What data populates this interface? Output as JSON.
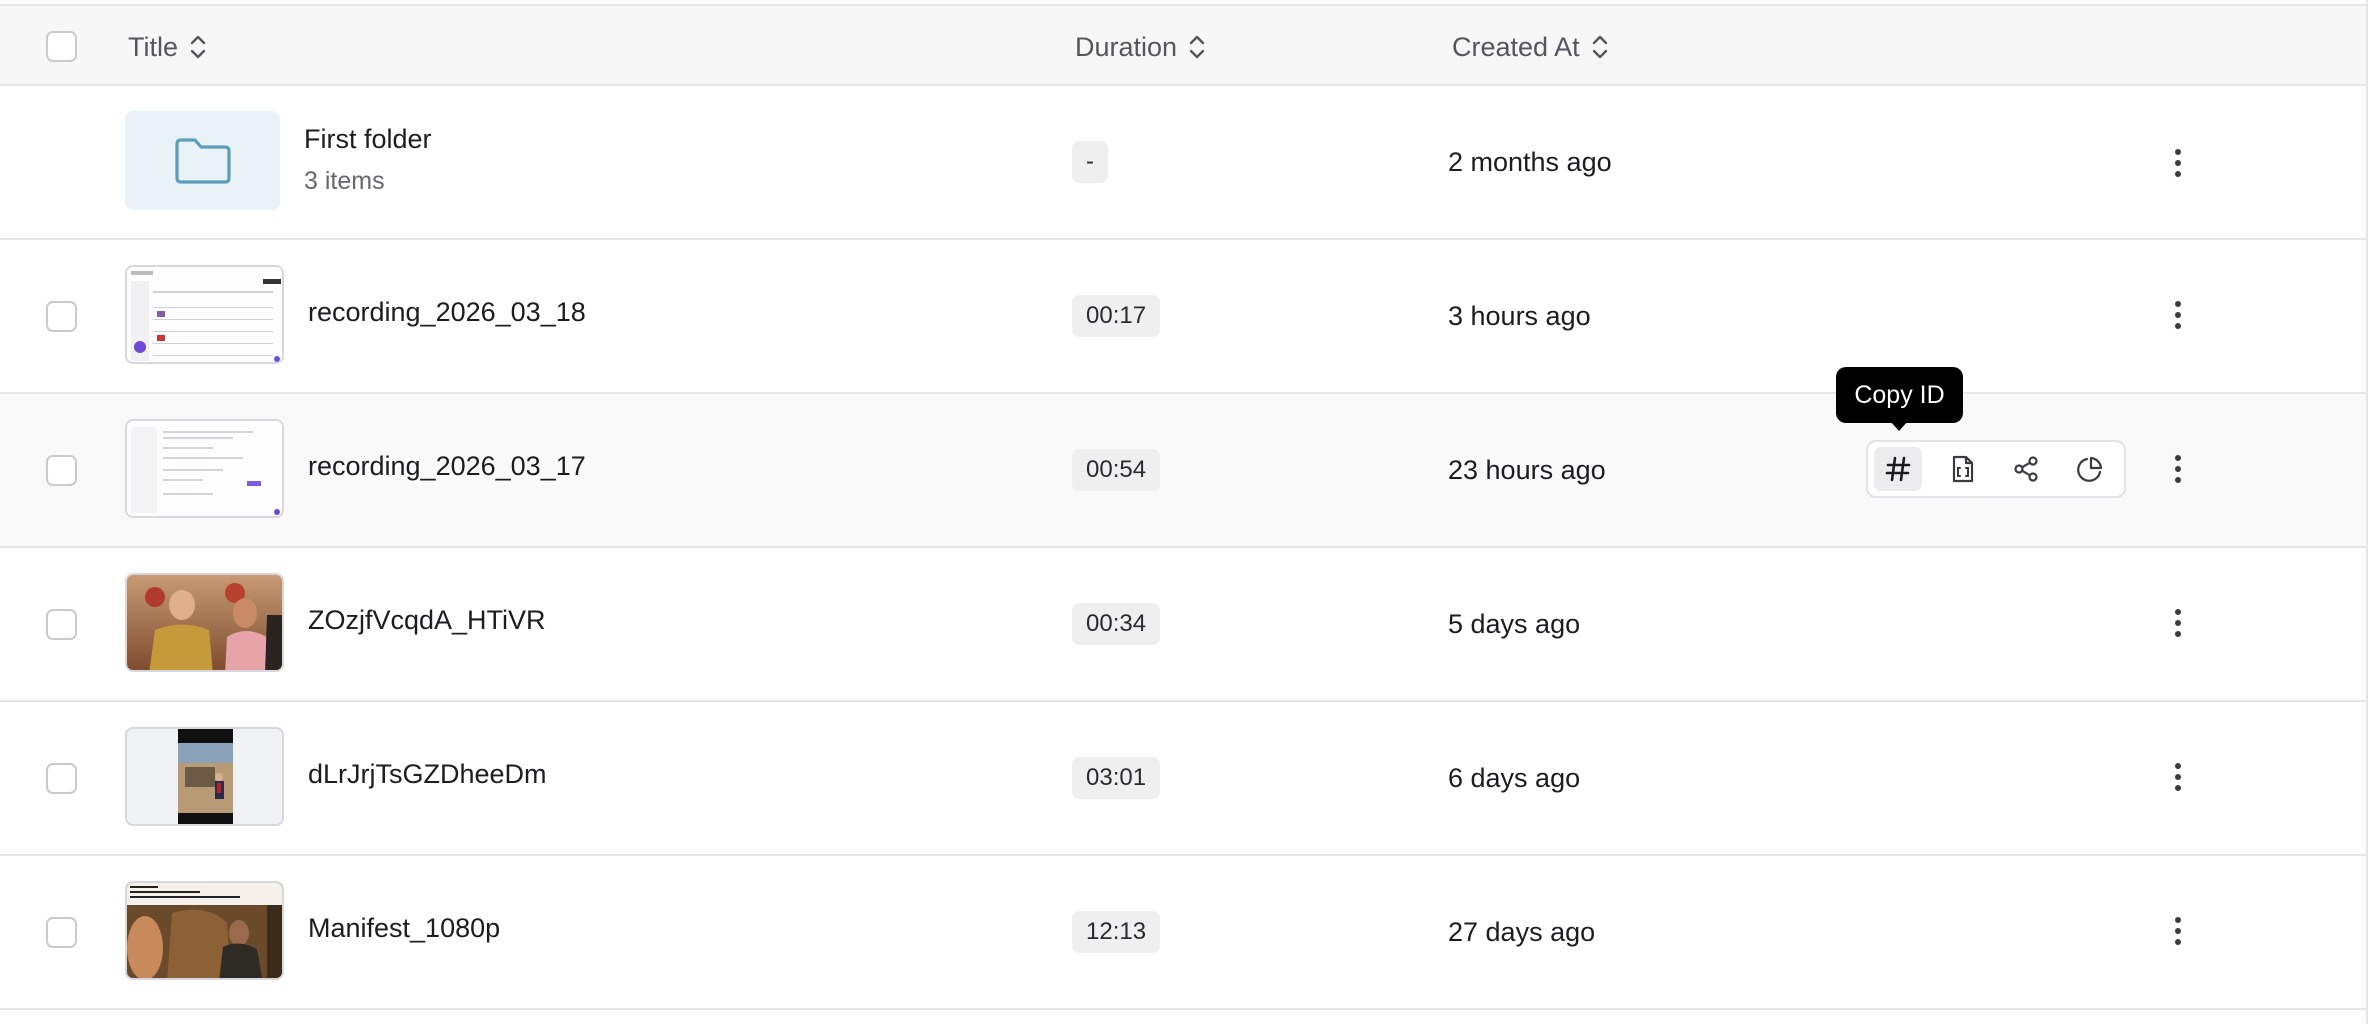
{
  "header": {
    "title_label": "Title",
    "duration_label": "Duration",
    "created_label": "Created At"
  },
  "rows": [
    {
      "kind": "folder",
      "name": "First folder",
      "subtitle": "3 items",
      "duration": "-",
      "created": "2 months ago"
    },
    {
      "kind": "video",
      "name": "recording_2026_03_18",
      "duration": "00:17",
      "created": "3 hours ago"
    },
    {
      "kind": "video",
      "name": "recording_2026_03_17",
      "duration": "00:54",
      "created": "23 hours ago"
    },
    {
      "kind": "video",
      "name": "ZOzjfVcqdA_HTiVR",
      "duration": "00:34",
      "created": "5 days ago"
    },
    {
      "kind": "video",
      "name": "dLrJrjTsGZDheeDm",
      "duration": "03:01",
      "created": "6 days ago"
    },
    {
      "kind": "video",
      "name": "Manifest_1080p",
      "duration": "12:13",
      "created": "27 days ago"
    }
  ],
  "tooltip": {
    "text": "Copy ID"
  },
  "actions": [
    {
      "icon": "hash-icon",
      "label": "Copy ID"
    },
    {
      "icon": "file-code-icon"
    },
    {
      "icon": "share-icon"
    },
    {
      "icon": "pie-chart-icon"
    }
  ],
  "colors": {
    "folder_bg": "#e9f3f7",
    "folder_icon": "#5b9fb8",
    "tooltip_bg": "#000000"
  }
}
